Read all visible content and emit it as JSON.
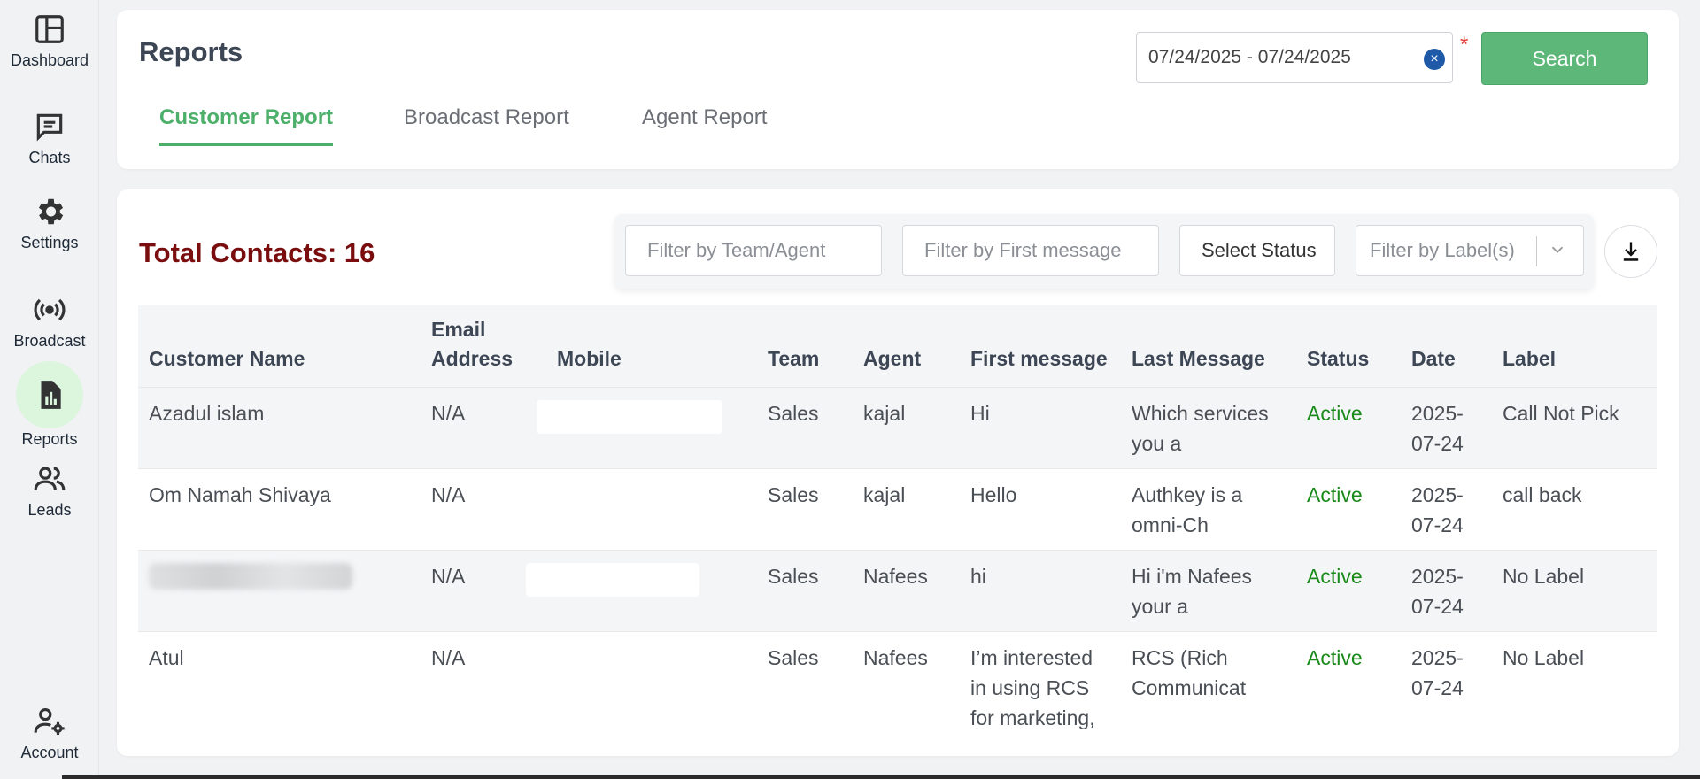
{
  "sidebar": {
    "items": [
      {
        "label": "Dashboard",
        "icon": "dashboard-icon"
      },
      {
        "label": "Chats",
        "icon": "chat-icon"
      },
      {
        "label": "Settings",
        "icon": "gear-icon"
      },
      {
        "label": "Broadcast",
        "icon": "broadcast-icon"
      },
      {
        "label": "Reports",
        "icon": "report-icon"
      },
      {
        "label": "Leads",
        "icon": "users-icon"
      },
      {
        "label": "Account",
        "icon": "account-settings-icon"
      }
    ]
  },
  "header": {
    "title": "Reports",
    "tabs": [
      {
        "label": "Customer Report"
      },
      {
        "label": "Broadcast Report"
      },
      {
        "label": "Agent Report"
      }
    ],
    "date_range": "07/24/2025 - 07/24/2025",
    "clear_symbol": "×",
    "required_marker": "*",
    "search_label": "Search"
  },
  "main": {
    "total_contacts": "Total Contacts: 16",
    "filters": {
      "team_agent_placeholder": "Filter by Team/Agent",
      "first_message_placeholder": "Filter by First message",
      "status_label": "Select Status",
      "label_placeholder": "Filter by Label(s)"
    },
    "table": {
      "headers": {
        "customer_name": "Customer Name",
        "email_line1": "Email",
        "email_line2": "Address",
        "mobile": "Mobile",
        "team": "Team",
        "agent": "Agent",
        "first_message": "First message",
        "last_message": "Last Message",
        "status": "Status",
        "date": "Date",
        "label": "Label"
      },
      "rows": [
        {
          "name": "Azadul islam",
          "email": "N/A",
          "team": "Sales",
          "agent": "kajal",
          "first_1": "Hi",
          "first_2": "",
          "first_3": "",
          "last_1": "Which services",
          "last_2": "you a",
          "status": "Active",
          "date_1": "2025-",
          "date_2": "07-24",
          "label": "Call Not Pick"
        },
        {
          "name": "Om Namah Shivaya",
          "email": "N/A",
          "team": "Sales",
          "agent": "kajal",
          "first_1": "Hello",
          "first_2": "",
          "first_3": "",
          "last_1": "Authkey is a",
          "last_2": "omni-Ch",
          "status": "Active",
          "date_1": "2025-",
          "date_2": "07-24",
          "label": "call back"
        },
        {
          "name": "",
          "email": "N/A",
          "team": "Sales",
          "agent": "Nafees",
          "first_1": "hi",
          "first_2": "",
          "first_3": "",
          "last_1": "Hi i'm Nafees",
          "last_2": "your a",
          "status": "Active",
          "date_1": "2025-",
          "date_2": "07-24",
          "label": "No Label"
        },
        {
          "name": "Atul",
          "email": "N/A",
          "team": "Sales",
          "agent": "Nafees",
          "first_1": "I’m interested",
          "first_2": "in using RCS",
          "first_3": "for marketing,",
          "last_1": "RCS (Rich",
          "last_2": "Communicat",
          "status": "Active",
          "date_1": "2025-",
          "date_2": "07-24",
          "label": "No Label"
        }
      ]
    }
  },
  "colors": {
    "accent_green": "#4caf6a",
    "button_green": "#5cb779",
    "total_contacts": "#7a0d0d",
    "status_active": "#1a8a1a"
  }
}
